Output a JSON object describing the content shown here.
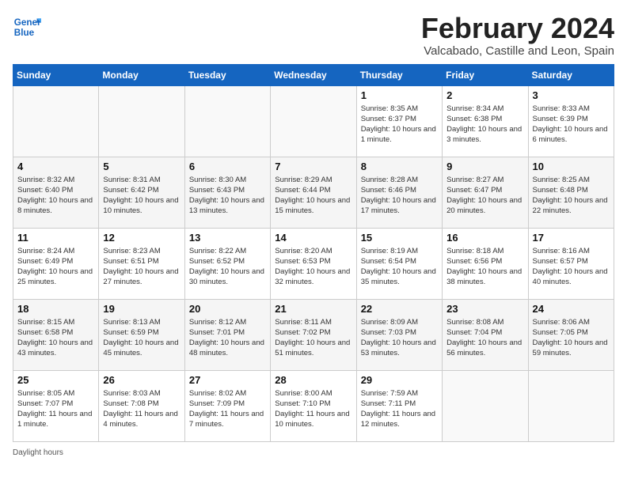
{
  "header": {
    "logo_line1": "General",
    "logo_line2": "Blue",
    "month": "February 2024",
    "location": "Valcabado, Castille and Leon, Spain"
  },
  "days_of_week": [
    "Sunday",
    "Monday",
    "Tuesday",
    "Wednesday",
    "Thursday",
    "Friday",
    "Saturday"
  ],
  "weeks": [
    [
      {
        "day": "",
        "info": ""
      },
      {
        "day": "",
        "info": ""
      },
      {
        "day": "",
        "info": ""
      },
      {
        "day": "",
        "info": ""
      },
      {
        "day": "1",
        "info": "Sunrise: 8:35 AM\nSunset: 6:37 PM\nDaylight: 10 hours and 1 minute."
      },
      {
        "day": "2",
        "info": "Sunrise: 8:34 AM\nSunset: 6:38 PM\nDaylight: 10 hours and 3 minutes."
      },
      {
        "day": "3",
        "info": "Sunrise: 8:33 AM\nSunset: 6:39 PM\nDaylight: 10 hours and 6 minutes."
      }
    ],
    [
      {
        "day": "4",
        "info": "Sunrise: 8:32 AM\nSunset: 6:40 PM\nDaylight: 10 hours and 8 minutes."
      },
      {
        "day": "5",
        "info": "Sunrise: 8:31 AM\nSunset: 6:42 PM\nDaylight: 10 hours and 10 minutes."
      },
      {
        "day": "6",
        "info": "Sunrise: 8:30 AM\nSunset: 6:43 PM\nDaylight: 10 hours and 13 minutes."
      },
      {
        "day": "7",
        "info": "Sunrise: 8:29 AM\nSunset: 6:44 PM\nDaylight: 10 hours and 15 minutes."
      },
      {
        "day": "8",
        "info": "Sunrise: 8:28 AM\nSunset: 6:46 PM\nDaylight: 10 hours and 17 minutes."
      },
      {
        "day": "9",
        "info": "Sunrise: 8:27 AM\nSunset: 6:47 PM\nDaylight: 10 hours and 20 minutes."
      },
      {
        "day": "10",
        "info": "Sunrise: 8:25 AM\nSunset: 6:48 PM\nDaylight: 10 hours and 22 minutes."
      }
    ],
    [
      {
        "day": "11",
        "info": "Sunrise: 8:24 AM\nSunset: 6:49 PM\nDaylight: 10 hours and 25 minutes."
      },
      {
        "day": "12",
        "info": "Sunrise: 8:23 AM\nSunset: 6:51 PM\nDaylight: 10 hours and 27 minutes."
      },
      {
        "day": "13",
        "info": "Sunrise: 8:22 AM\nSunset: 6:52 PM\nDaylight: 10 hours and 30 minutes."
      },
      {
        "day": "14",
        "info": "Sunrise: 8:20 AM\nSunset: 6:53 PM\nDaylight: 10 hours and 32 minutes."
      },
      {
        "day": "15",
        "info": "Sunrise: 8:19 AM\nSunset: 6:54 PM\nDaylight: 10 hours and 35 minutes."
      },
      {
        "day": "16",
        "info": "Sunrise: 8:18 AM\nSunset: 6:56 PM\nDaylight: 10 hours and 38 minutes."
      },
      {
        "day": "17",
        "info": "Sunrise: 8:16 AM\nSunset: 6:57 PM\nDaylight: 10 hours and 40 minutes."
      }
    ],
    [
      {
        "day": "18",
        "info": "Sunrise: 8:15 AM\nSunset: 6:58 PM\nDaylight: 10 hours and 43 minutes."
      },
      {
        "day": "19",
        "info": "Sunrise: 8:13 AM\nSunset: 6:59 PM\nDaylight: 10 hours and 45 minutes."
      },
      {
        "day": "20",
        "info": "Sunrise: 8:12 AM\nSunset: 7:01 PM\nDaylight: 10 hours and 48 minutes."
      },
      {
        "day": "21",
        "info": "Sunrise: 8:11 AM\nSunset: 7:02 PM\nDaylight: 10 hours and 51 minutes."
      },
      {
        "day": "22",
        "info": "Sunrise: 8:09 AM\nSunset: 7:03 PM\nDaylight: 10 hours and 53 minutes."
      },
      {
        "day": "23",
        "info": "Sunrise: 8:08 AM\nSunset: 7:04 PM\nDaylight: 10 hours and 56 minutes."
      },
      {
        "day": "24",
        "info": "Sunrise: 8:06 AM\nSunset: 7:05 PM\nDaylight: 10 hours and 59 minutes."
      }
    ],
    [
      {
        "day": "25",
        "info": "Sunrise: 8:05 AM\nSunset: 7:07 PM\nDaylight: 11 hours and 1 minute."
      },
      {
        "day": "26",
        "info": "Sunrise: 8:03 AM\nSunset: 7:08 PM\nDaylight: 11 hours and 4 minutes."
      },
      {
        "day": "27",
        "info": "Sunrise: 8:02 AM\nSunset: 7:09 PM\nDaylight: 11 hours and 7 minutes."
      },
      {
        "day": "28",
        "info": "Sunrise: 8:00 AM\nSunset: 7:10 PM\nDaylight: 11 hours and 10 minutes."
      },
      {
        "day": "29",
        "info": "Sunrise: 7:59 AM\nSunset: 7:11 PM\nDaylight: 11 hours and 12 minutes."
      },
      {
        "day": "",
        "info": ""
      },
      {
        "day": "",
        "info": ""
      }
    ]
  ],
  "footer": "Daylight hours"
}
